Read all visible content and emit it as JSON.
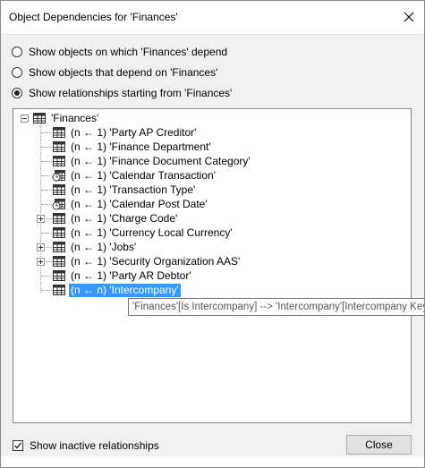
{
  "window": {
    "title": "Object Dependencies for 'Finances'"
  },
  "options": {
    "radio1": "Show objects on which 'Finances' depend",
    "radio2": "Show objects that depend on 'Finances'",
    "radio3": "Show relationships starting from 'Finances'",
    "selected": "radio3"
  },
  "tree": {
    "root": "'Finances'",
    "children": [
      {
        "label": "(n ← 1) 'Party AP Creditor'",
        "icon": "table-icon",
        "expandable": false
      },
      {
        "label": "(n ← 1) 'Finance Department'",
        "icon": "table-icon",
        "expandable": false
      },
      {
        "label": "(n ← 1) 'Finance Document Category'",
        "icon": "table-icon",
        "expandable": false
      },
      {
        "label": "(n ← 1) 'Calendar Transaction'",
        "icon": "calendar-table-icon",
        "expandable": false
      },
      {
        "label": "(n ← 1) 'Transaction Type'",
        "icon": "table-icon",
        "expandable": false
      },
      {
        "label": "(n ← 1) 'Calendar Post Date'",
        "icon": "calendar-table-icon",
        "expandable": false
      },
      {
        "label": "(n ← 1) 'Charge Code'",
        "icon": "table-icon",
        "expandable": true
      },
      {
        "label": "(n ← 1) 'Currency Local Currency'",
        "icon": "table-icon",
        "expandable": false
      },
      {
        "label": "(n ← 1) 'Jobs'",
        "icon": "table-icon",
        "expandable": true
      },
      {
        "label": "(n ← 1) 'Security Organization AAS'",
        "icon": "table-icon",
        "expandable": true
      },
      {
        "label": "(n ← 1) 'Party AR Debtor'",
        "icon": "table-icon",
        "expandable": false
      },
      {
        "label": "(n ← n) 'Intercompany'",
        "icon": "table-icon",
        "expandable": false,
        "selected": true
      }
    ]
  },
  "tooltip": "'Finances'[Is Intercompany] --> 'Intercompany'[Intercompany Key]",
  "footer": {
    "checkbox_label": "Show inactive relationships",
    "checkbox_checked": true,
    "close_label": "Close"
  }
}
